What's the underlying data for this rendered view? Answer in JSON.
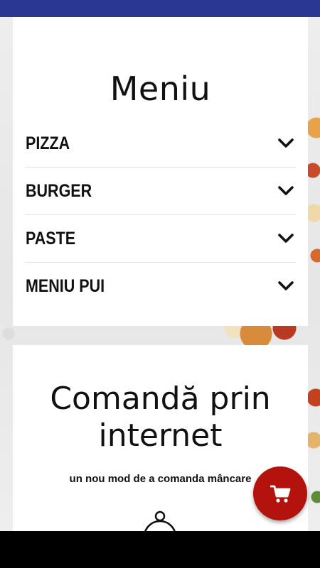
{
  "menu": {
    "title": "Meniu",
    "items": [
      {
        "label": "PIZZA"
      },
      {
        "label": "BURGER"
      },
      {
        "label": "PASTE"
      },
      {
        "label": "MENIU PUI"
      }
    ]
  },
  "order": {
    "title_line1": "Comandă prin",
    "title_line2": "internet",
    "subtitle": "un nou mod de a comanda mâncare"
  },
  "colors": {
    "status_bar": "#2b3893",
    "fab": "#b4120c",
    "nav_bar": "#000000"
  },
  "icons": {
    "expand": "chevron-down-icon",
    "cart": "shopping-cart-icon",
    "food": "cloche-icon"
  }
}
